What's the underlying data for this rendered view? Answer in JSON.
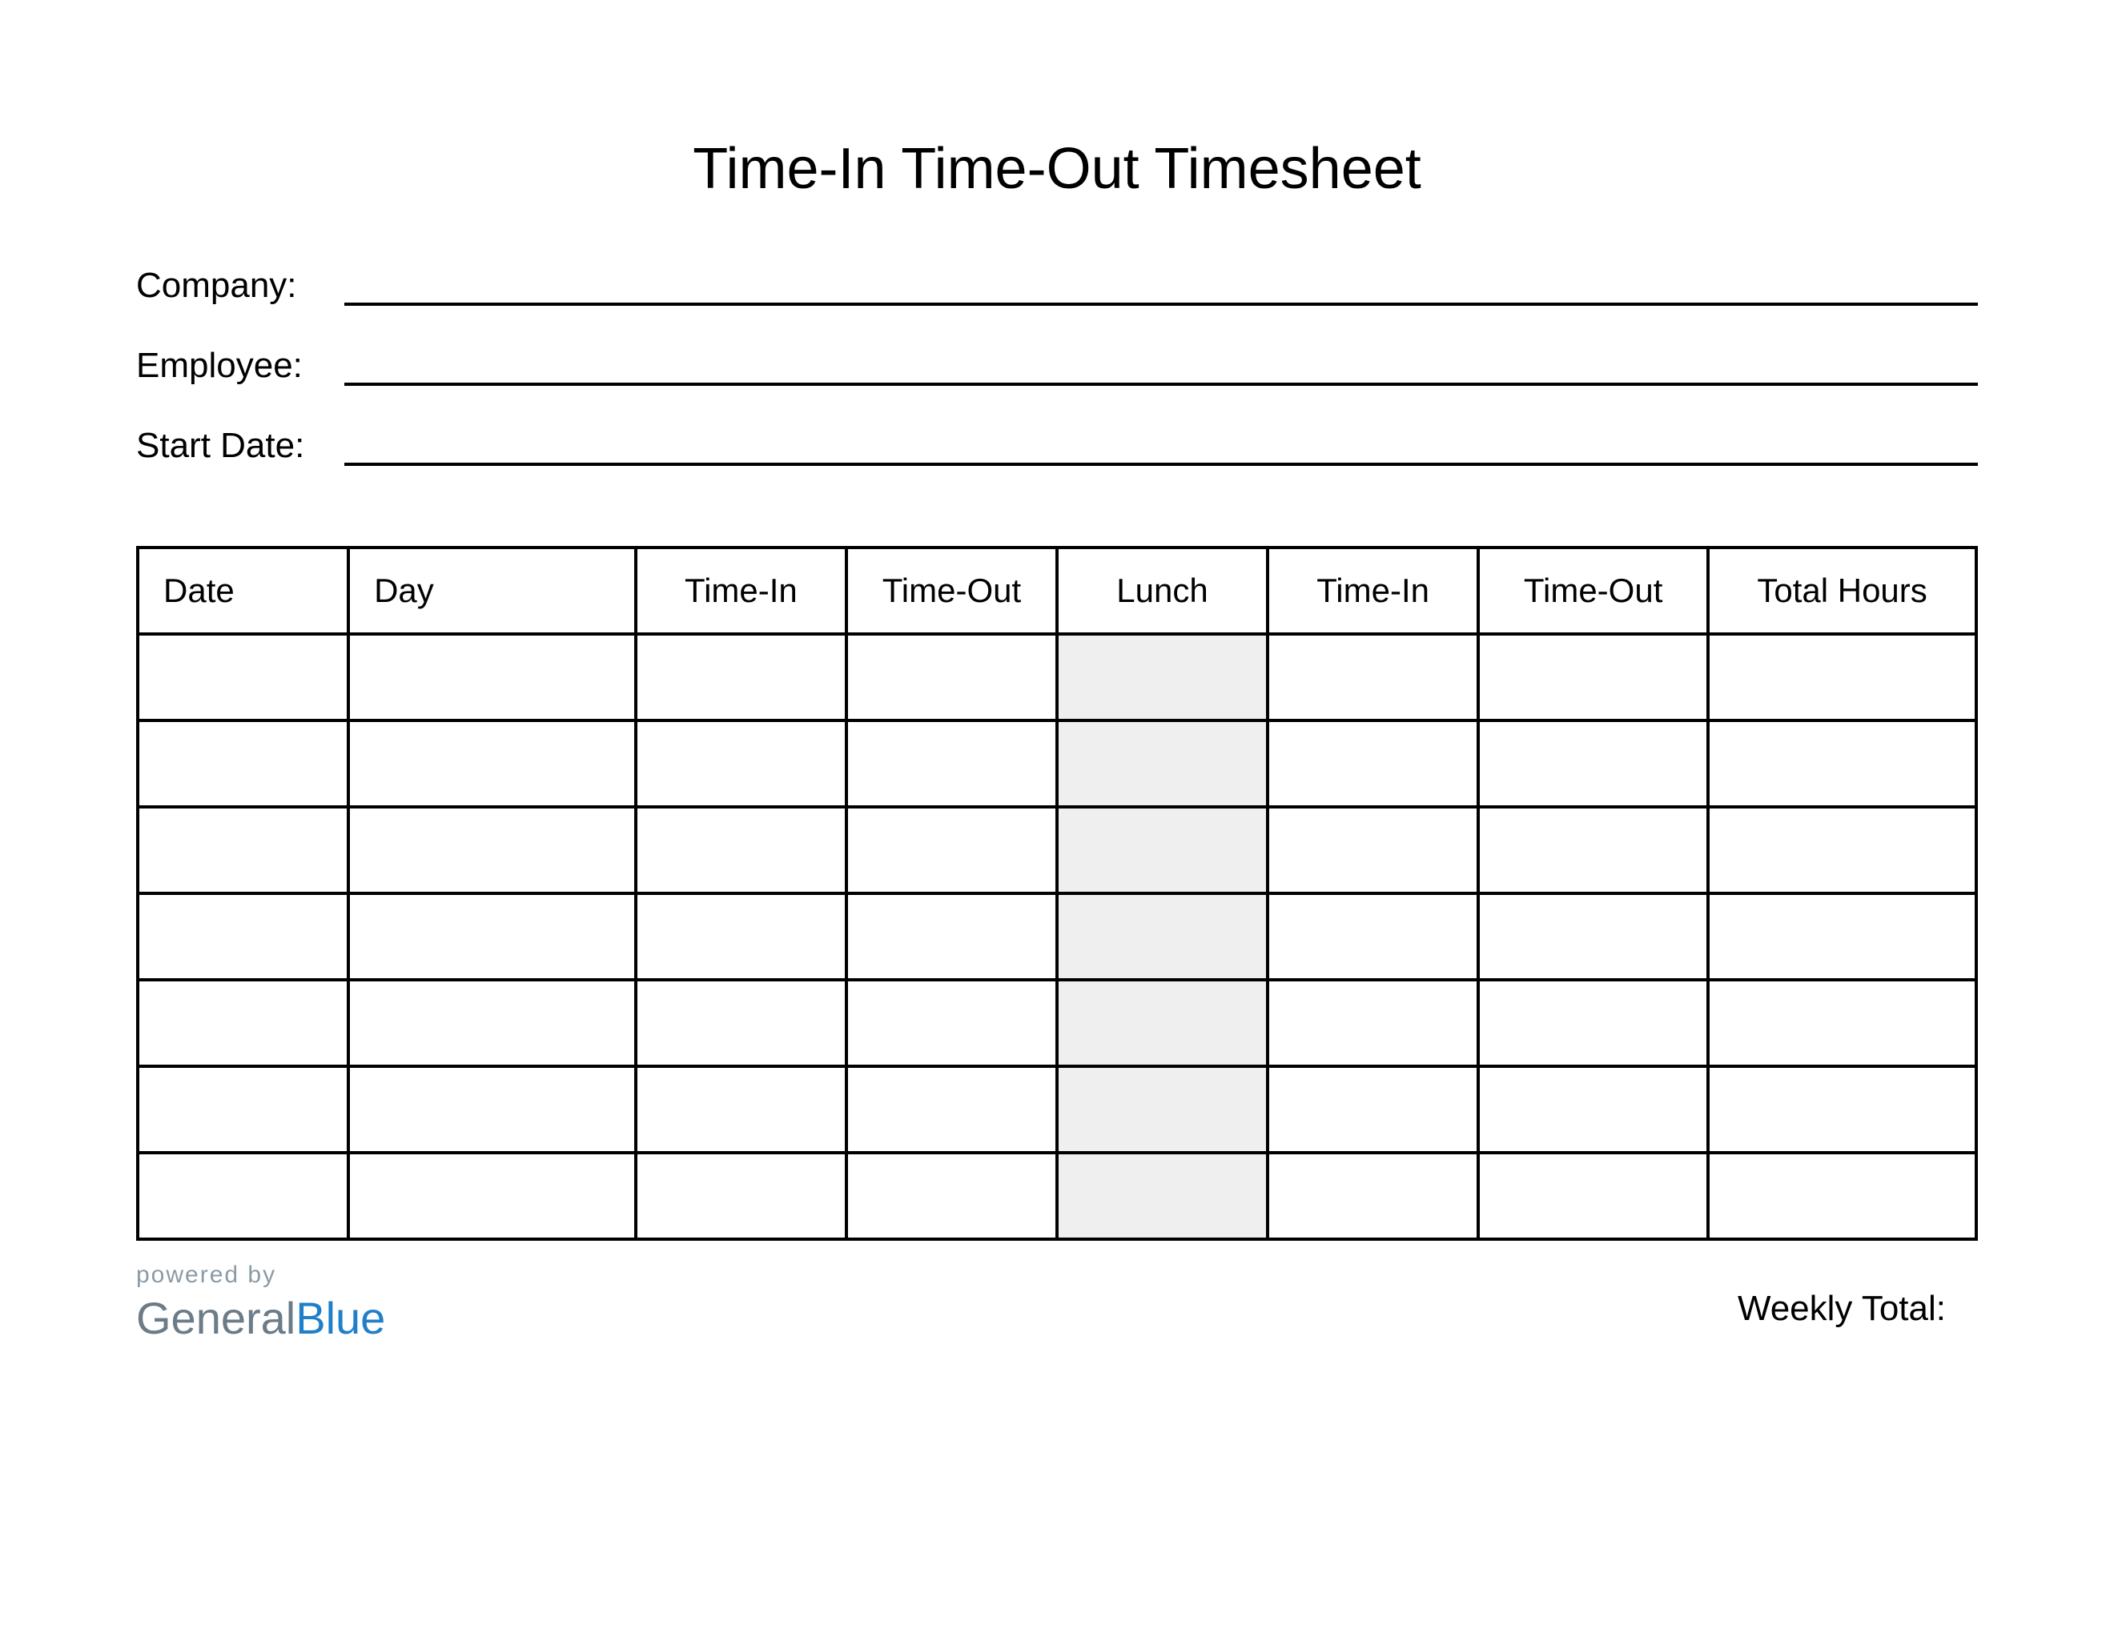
{
  "title": "Time-In Time-Out Timesheet",
  "info": {
    "company_label": "Company:",
    "employee_label": "Employee:",
    "start_date_label": "Start Date:",
    "company_value": "",
    "employee_value": "",
    "start_date_value": ""
  },
  "table": {
    "headers": {
      "date": "Date",
      "day": "Day",
      "time_in_1": "Time-In",
      "time_out_1": "Time-Out",
      "lunch": "Lunch",
      "time_in_2": "Time-In",
      "time_out_2": "Time-Out",
      "total_hours": "Total Hours"
    },
    "rows": [
      {
        "date": "",
        "day": "",
        "time_in_1": "",
        "time_out_1": "",
        "lunch": "",
        "time_in_2": "",
        "time_out_2": "",
        "total_hours": ""
      },
      {
        "date": "",
        "day": "",
        "time_in_1": "",
        "time_out_1": "",
        "lunch": "",
        "time_in_2": "",
        "time_out_2": "",
        "total_hours": ""
      },
      {
        "date": "",
        "day": "",
        "time_in_1": "",
        "time_out_1": "",
        "lunch": "",
        "time_in_2": "",
        "time_out_2": "",
        "total_hours": ""
      },
      {
        "date": "",
        "day": "",
        "time_in_1": "",
        "time_out_1": "",
        "lunch": "",
        "time_in_2": "",
        "time_out_2": "",
        "total_hours": ""
      },
      {
        "date": "",
        "day": "",
        "time_in_1": "",
        "time_out_1": "",
        "lunch": "",
        "time_in_2": "",
        "time_out_2": "",
        "total_hours": ""
      },
      {
        "date": "",
        "day": "",
        "time_in_1": "",
        "time_out_1": "",
        "lunch": "",
        "time_in_2": "",
        "time_out_2": "",
        "total_hours": ""
      },
      {
        "date": "",
        "day": "",
        "time_in_1": "",
        "time_out_1": "",
        "lunch": "",
        "time_in_2": "",
        "time_out_2": "",
        "total_hours": ""
      }
    ]
  },
  "footer": {
    "powered_by": "powered by",
    "brand_general": "General",
    "brand_blue": "Blue",
    "weekly_total_label": "Weekly Total:",
    "weekly_total_value": ""
  }
}
